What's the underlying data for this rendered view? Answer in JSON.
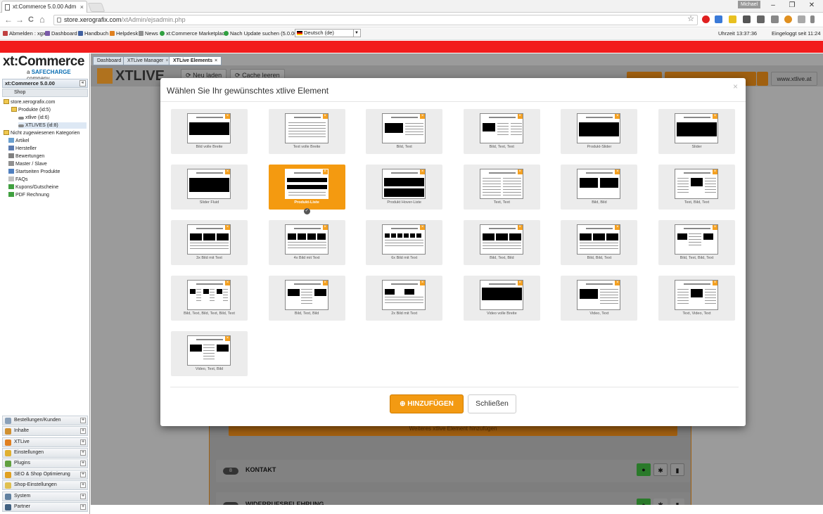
{
  "browser": {
    "tab_title": "xt:Commerce 5.0.00 Adm",
    "tab_close": "×",
    "user_badge": "Michael",
    "minimize": "–",
    "restore": "❐",
    "close": "✕",
    "back": "←",
    "forward": "→",
    "reload": "C",
    "home": "⌂",
    "url_host": "store.xerografix.com",
    "url_path": "/xtAdmin/ejsadmin.php",
    "star": "☆"
  },
  "bookmarks": {
    "items": [
      {
        "label": "Abmelden : xgx",
        "color": "#c04040"
      },
      {
        "label": "Dashboard",
        "color": "#7a5aa8"
      },
      {
        "label": "Handbuch",
        "color": "#4060a0"
      },
      {
        "label": "Helpdesk",
        "color": "#e08020"
      },
      {
        "label": "News",
        "color": "#909090"
      },
      {
        "label": "xt:Commerce Marketplace",
        "color": "#30a040"
      },
      {
        "label": "Nach Update suchen (5.0.00)",
        "color": "#30a040"
      }
    ],
    "language": "Deutsch (de)",
    "time": "Uhrzeit 13:37:36",
    "logged_in": "Eingeloggt seit 11:24"
  },
  "sidebar": {
    "logo_main": "xt:Commerce",
    "logo_sub_prefix": "a",
    "logo_sub_brand": "SAFECHARGE",
    "logo_sub_suffix": "company",
    "version_header": "xt:Commerce 5.0.00",
    "collapse": "«",
    "shop_header": "Shop",
    "tree": [
      "store.xerografix.com",
      "Produkte (id:5)",
      "xtlive (id:6)",
      "XTLIVES (id:8)",
      "Nicht zugewiesenen Kategorien",
      "Artikel",
      "Hersteller",
      "Bewertungen",
      "Master / Slave",
      "Startseiten Produkte",
      "FAQs",
      "Kupons/Gutscheine",
      "PDF Rechnung"
    ],
    "accordion": [
      "Bestellungen/Kunden",
      "Inhalte",
      "XTLive",
      "Einstellungen",
      "Plugins",
      "SEO & Shop Optimierung",
      "Shop-Einstellungen",
      "System",
      "Partner"
    ],
    "plus": "+"
  },
  "app_tabs": [
    "Dashboard",
    "XTLive Manager",
    "XTLive Elements"
  ],
  "toolbar": {
    "logo": "XTLIVE",
    "reload": "Neu laden",
    "cache": "Cache leeren",
    "site": "www.xtlive.at"
  },
  "background": {
    "add_bar": "Weiteres xtlive Element hinzufügen",
    "kontakt": "KONTAKT",
    "kontakt_num": "8",
    "widerruf": "WIDERRUFSBELEHRUNG"
  },
  "modal": {
    "title": "Wählen Sie Ihr gewünschtes xtlive Element",
    "close": "×",
    "add_button": "HINZUFÜGEN",
    "close_button": "Schließen",
    "selected_index": 7,
    "elements": [
      "Bild volle Breite",
      "Text volle Breite",
      "Bild, Text",
      "Bild, Text, Text",
      "Produkt-Slider",
      "Slider",
      "Slider Fluid",
      "Produkt-Liste",
      "Produkt Hover-Liste",
      "Text, Text",
      "Bild, Bild",
      "Text, Bild, Text",
      "3x Bild mit Text",
      "4x Bild mit Text",
      "6x Bild mit Text",
      "Bild, Text, Bild",
      "Bild, Bild, Text",
      "Bild, Text, Bild, Text",
      "Bild, Text, Bild, Text, Bild, Text",
      "Bild, Text, Bild",
      "2x Bild mit Text",
      "Video volle Breite",
      "Video, Text",
      "Text, Video, Text",
      "Video, Text, Bild"
    ]
  }
}
